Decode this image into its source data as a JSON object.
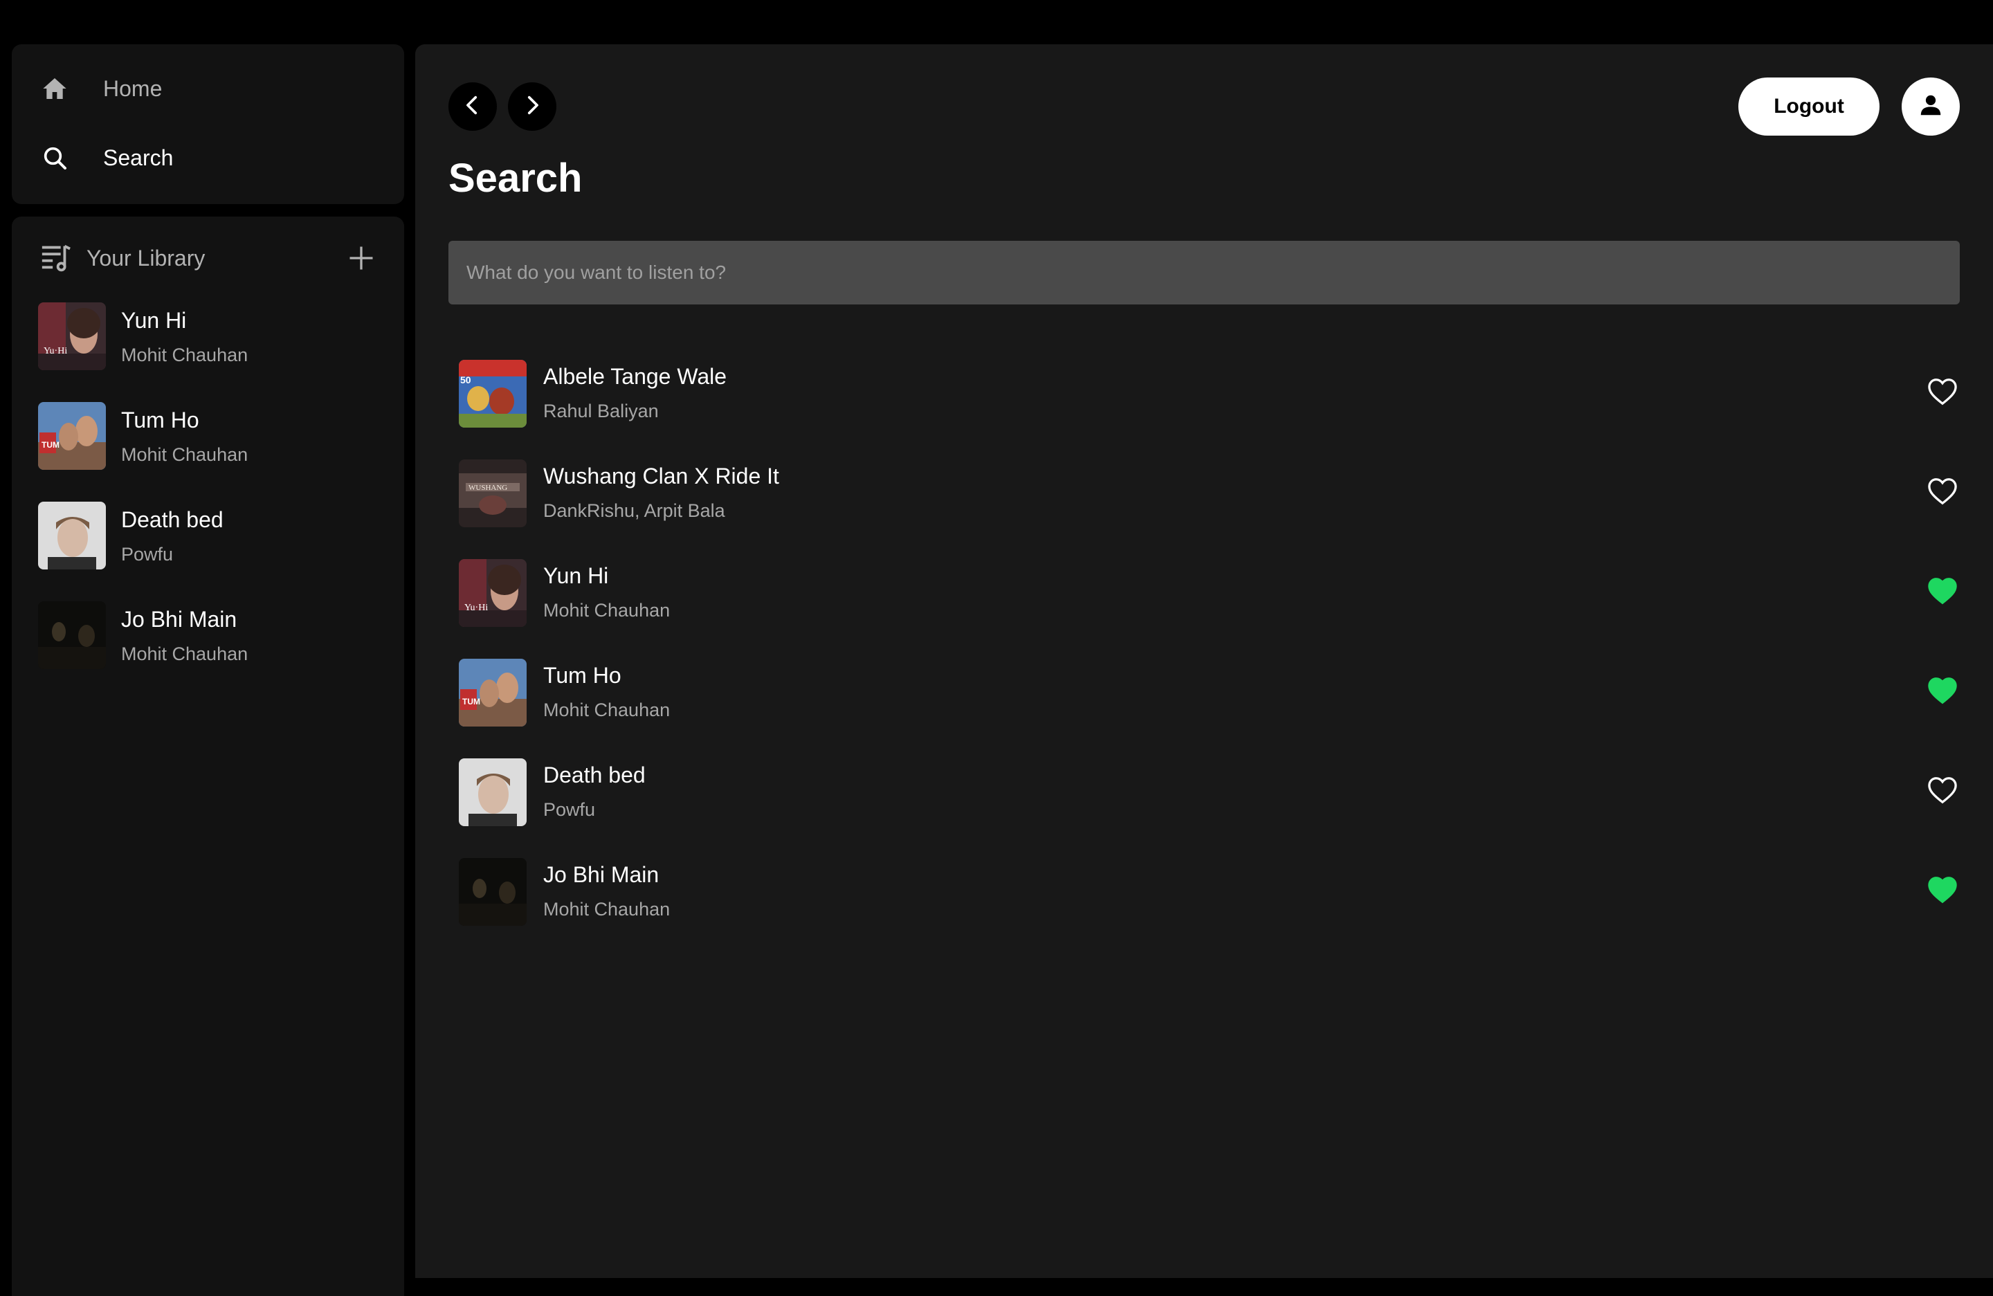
{
  "sidebar": {
    "nav": {
      "home_label": "Home",
      "search_label": "Search"
    },
    "library": {
      "title": "Your Library",
      "items": [
        {
          "title": "Yun Hi",
          "artist": "Mohit Chauhan"
        },
        {
          "title": "Tum Ho",
          "artist": "Mohit Chauhan"
        },
        {
          "title": "Death bed",
          "artist": "Powfu"
        },
        {
          "title": "Jo Bhi Main",
          "artist": "Mohit Chauhan"
        }
      ]
    }
  },
  "header": {
    "logout_label": "Logout"
  },
  "main": {
    "page_title": "Search",
    "search": {
      "placeholder": "What do you want to listen to?",
      "value": ""
    },
    "results": [
      {
        "title": "Albele Tange Wale",
        "artist": "Rahul Baliyan",
        "liked": false
      },
      {
        "title": "Wushang Clan X Ride It",
        "artist": "DankRishu, Arpit Bala",
        "liked": false
      },
      {
        "title": "Yun Hi",
        "artist": "Mohit Chauhan",
        "liked": true
      },
      {
        "title": "Tum Ho",
        "artist": "Mohit Chauhan",
        "liked": true
      },
      {
        "title": "Death bed",
        "artist": "Powfu",
        "liked": false
      },
      {
        "title": "Jo Bhi Main",
        "artist": "Mohit Chauhan",
        "liked": true
      }
    ]
  },
  "colors": {
    "accent": "#1ed760",
    "background": "#000000",
    "panel": "#121212",
    "main_panel": "#181818",
    "input_bg": "#4a4a4a"
  },
  "icons": {
    "home": "home-icon",
    "search": "search-icon",
    "library": "library-icon",
    "add": "plus-icon",
    "back": "chevron-left-icon",
    "forward": "chevron-right-icon",
    "user": "user-icon",
    "heart": "heart-icon"
  }
}
